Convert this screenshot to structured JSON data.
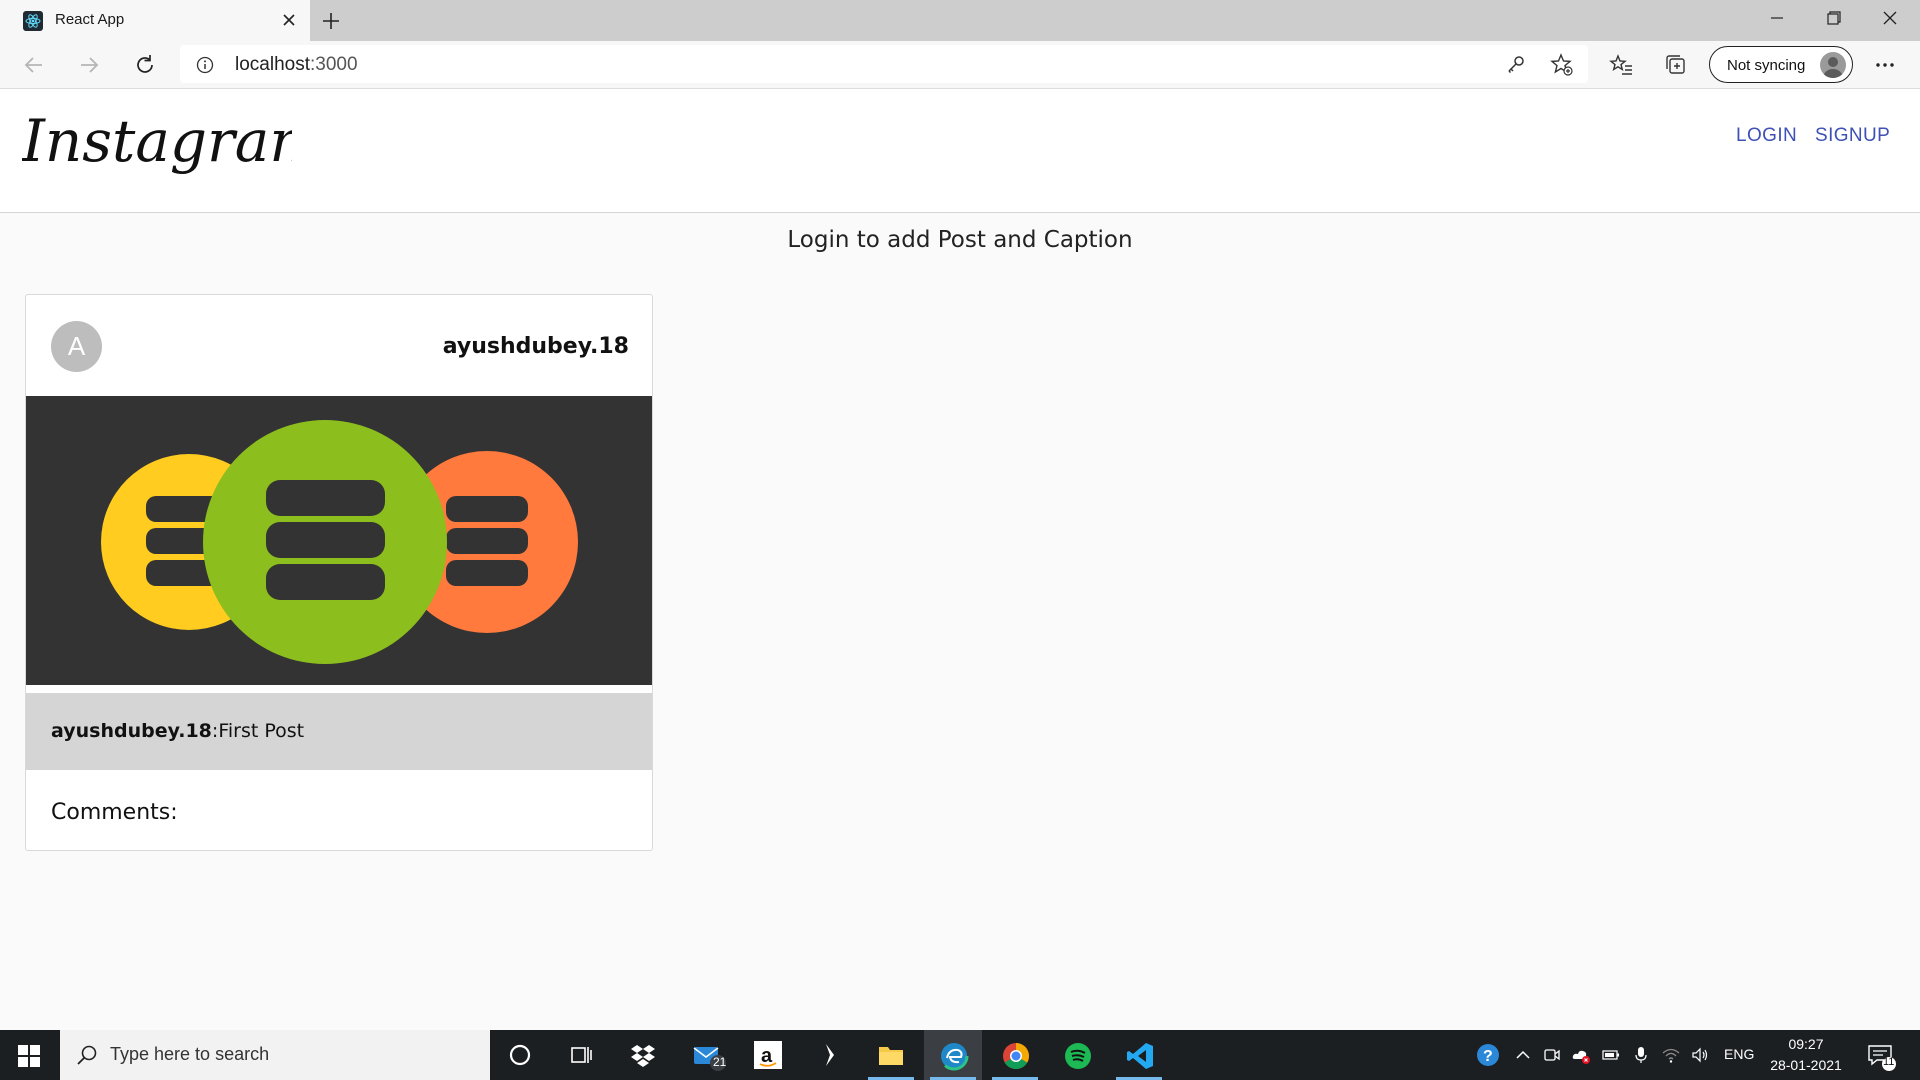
{
  "browser": {
    "tab_title": "React App",
    "url_host": "localhost",
    "url_port": ":3000",
    "sync_label": "Not syncing"
  },
  "app": {
    "logo_text": "Instagram",
    "login_label": "LOGIN",
    "signup_label": "SIGNUP",
    "accent_color": "#3f51b5",
    "login_message": "Login to add Post and Caption"
  },
  "post": {
    "avatar_letter": "A",
    "username": "ayushdubey.18",
    "caption_user": "ayushdubey.18",
    "caption_sep": ":",
    "caption_text": "First Post",
    "comments_label": "Comments:",
    "image_icon": "database-circles-icon"
  },
  "taskbar": {
    "search_placeholder": "Type here to search",
    "mail_badge": "21",
    "language": "ENG",
    "time": "09:27",
    "date": "28-01-2021",
    "notification_count": "11"
  }
}
